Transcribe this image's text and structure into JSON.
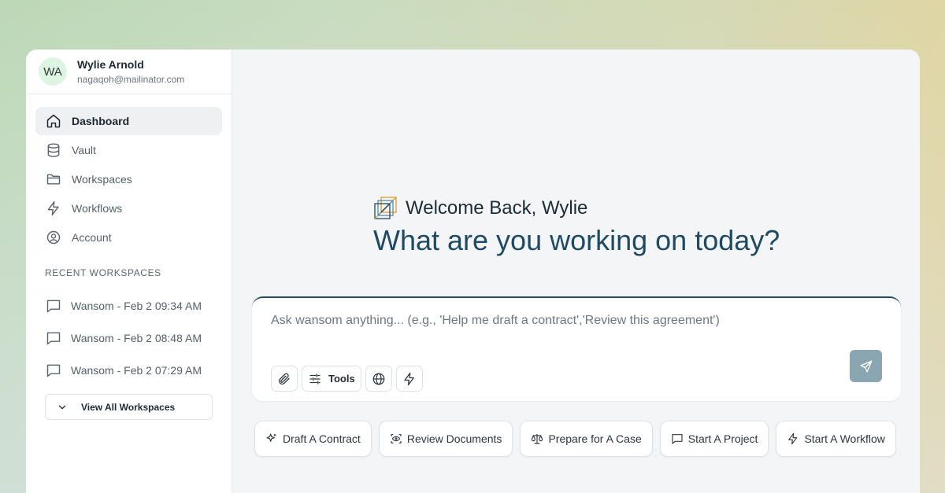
{
  "user": {
    "initials": "WA",
    "name": "Wylie Arnold",
    "email": "nagaqoh@mailinator.com"
  },
  "nav": {
    "items": [
      {
        "label": "Dashboard",
        "icon": "home-icon",
        "active": true
      },
      {
        "label": "Vault",
        "icon": "database-icon",
        "active": false
      },
      {
        "label": "Workspaces",
        "icon": "folder-icon",
        "active": false
      },
      {
        "label": "Workflows",
        "icon": "lightning-icon",
        "active": false
      },
      {
        "label": "Account",
        "icon": "user-circle-icon",
        "active": false
      }
    ]
  },
  "recent": {
    "title": "RECENT WORKSPACES",
    "items": [
      "Wansom - Feb 2 09:34 AM",
      "Wansom - Feb 2 08:48 AM",
      "Wansom - Feb 2 07:29 AM"
    ],
    "view_all_label": "View All Workspaces"
  },
  "main": {
    "welcome": "Welcome Back, Wylie",
    "headline": "What are you working on today?",
    "prompt_placeholder": "Ask wansom anything... (e.g., 'Help me draft a contract','Review this agreement')",
    "tools_label": "Tools"
  },
  "quick_actions": [
    {
      "label": "Draft A Contract",
      "icon": "sparkle-icon"
    },
    {
      "label": "Review Documents",
      "icon": "eye-scan-icon"
    },
    {
      "label": "Prepare for A Case",
      "icon": "scale-icon"
    },
    {
      "label": "Start A Project",
      "icon": "message-square-icon"
    },
    {
      "label": "Start A Workflow",
      "icon": "lightning-icon"
    }
  ],
  "colors": {
    "headline": "#1f4a63",
    "send_button": "#8aa7b1",
    "avatar_bg": "#dff5e3",
    "logo_orange": "#e09a3a",
    "logo_blue": "#1f4a63"
  }
}
